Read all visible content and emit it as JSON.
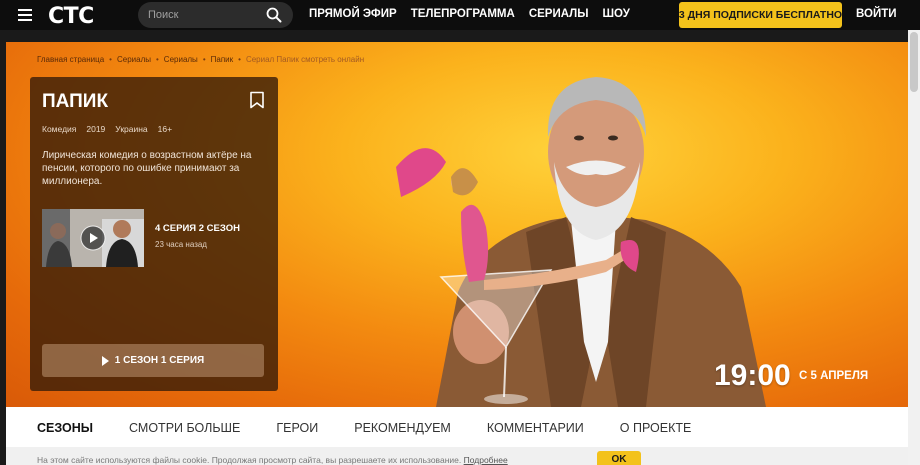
{
  "header": {
    "logo": "СТС",
    "search_placeholder": "Поиск",
    "nav": [
      "ПРЯМОЙ ЭФИР",
      "ТЕЛЕПРОГРАММА",
      "СЕРИАЛЫ",
      "ШОУ"
    ],
    "promo_label": "3 ДНЯ ПОДПИСКИ БЕСПЛАТНО",
    "login_label": "ВОЙТИ"
  },
  "breadcrumb": [
    "Главная страница",
    "Сериалы",
    "Сериалы",
    "Папик",
    "Сериал Папик смотреть онлайн"
  ],
  "show": {
    "title": "ПАПИК",
    "genre": "Комедия",
    "year": "2019",
    "country": "Украина",
    "age_rating": "16+",
    "description": "Лирическая комедия о возрастном актёре на пенсии, которого по ошибке принимают за миллионера.",
    "latest_episode": {
      "title": "4 СЕРИЯ 2 СЕЗОН",
      "time_ago": "23 часа назад"
    },
    "watch_label": "1 СЕЗОН 1 СЕРИЯ"
  },
  "schedule": {
    "time": "19:00",
    "date_label": "С 5 АПРЕЛЯ"
  },
  "tabs": [
    "СЕЗОНЫ",
    "СМОТРИ БОЛЬШЕ",
    "ГЕРОИ",
    "РЕКОМЕНДУЕМ",
    "КОММЕНТАРИИ",
    "О ПРОЕКТЕ"
  ],
  "active_tab": "СЕЗОНЫ",
  "cookie": {
    "text": "На этом сайте используются файлы cookie. Продолжая просмотр сайта, вы разрешаете их использование.",
    "link": "Подробнее",
    "ok_label": "OK"
  },
  "colors": {
    "accent": "#f3c21b",
    "topbar": "#0d0d0d",
    "hero_orange": "#f38a10"
  }
}
